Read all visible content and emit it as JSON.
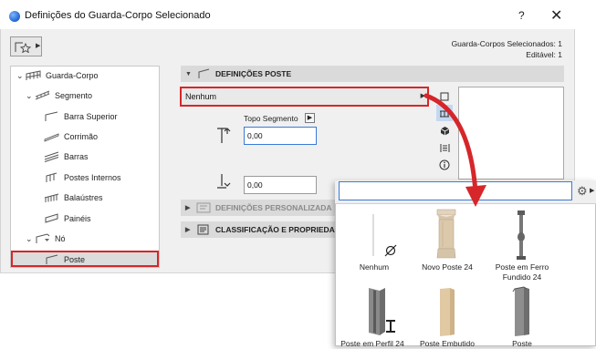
{
  "window": {
    "title": "Definições do Guarda-Corpo Selecionado",
    "help_label": "?",
    "close_label": "✕"
  },
  "header_info": {
    "selected_label": "Guarda-Corpos Selecionados: 1",
    "editable_label": "Editável: 1"
  },
  "tree": {
    "items": [
      {
        "label": "Guarda-Corpo",
        "icon": "railing-icon",
        "expanded": true
      },
      {
        "label": "Segmento",
        "icon": "segment-icon",
        "expanded": true
      },
      {
        "label": "Barra Superior",
        "icon": "top-rail-icon"
      },
      {
        "label": "Corrimão",
        "icon": "handrail-icon"
      },
      {
        "label": "Barras",
        "icon": "rails-icon"
      },
      {
        "label": "Postes Internos",
        "icon": "inner-posts-icon"
      },
      {
        "label": "Balaústres",
        "icon": "balusters-icon"
      },
      {
        "label": "Painéis",
        "icon": "panels-icon"
      },
      {
        "label": "Nó",
        "icon": "node-icon",
        "expanded": true
      },
      {
        "label": "Poste",
        "icon": "post-icon",
        "selected": true
      }
    ]
  },
  "panel": {
    "post_settings_title": "DEFINIÇÕES POSTE",
    "custom_settings_title": "DEFINIÇÕES PERSONALIZADA",
    "classification_title": "CLASSIFICAÇÃO E PROPRIEDA",
    "post_type_value": "Nenhum",
    "top_segment_label": "Topo Segmento",
    "top_value": "0,00",
    "bottom_value": "0,00"
  },
  "library": {
    "search_value": "",
    "items": [
      {
        "label": "Nenhum"
      },
      {
        "label": "Novo Poste 24"
      },
      {
        "label": "Poste em Ferro Fundido 24"
      },
      {
        "label": "Poste em Perfil 24"
      },
      {
        "label": "Poste Embutido"
      },
      {
        "label": "Poste"
      }
    ]
  },
  "colors": {
    "highlight_red": "#d6262a",
    "accent_blue": "#3a7bd5"
  }
}
